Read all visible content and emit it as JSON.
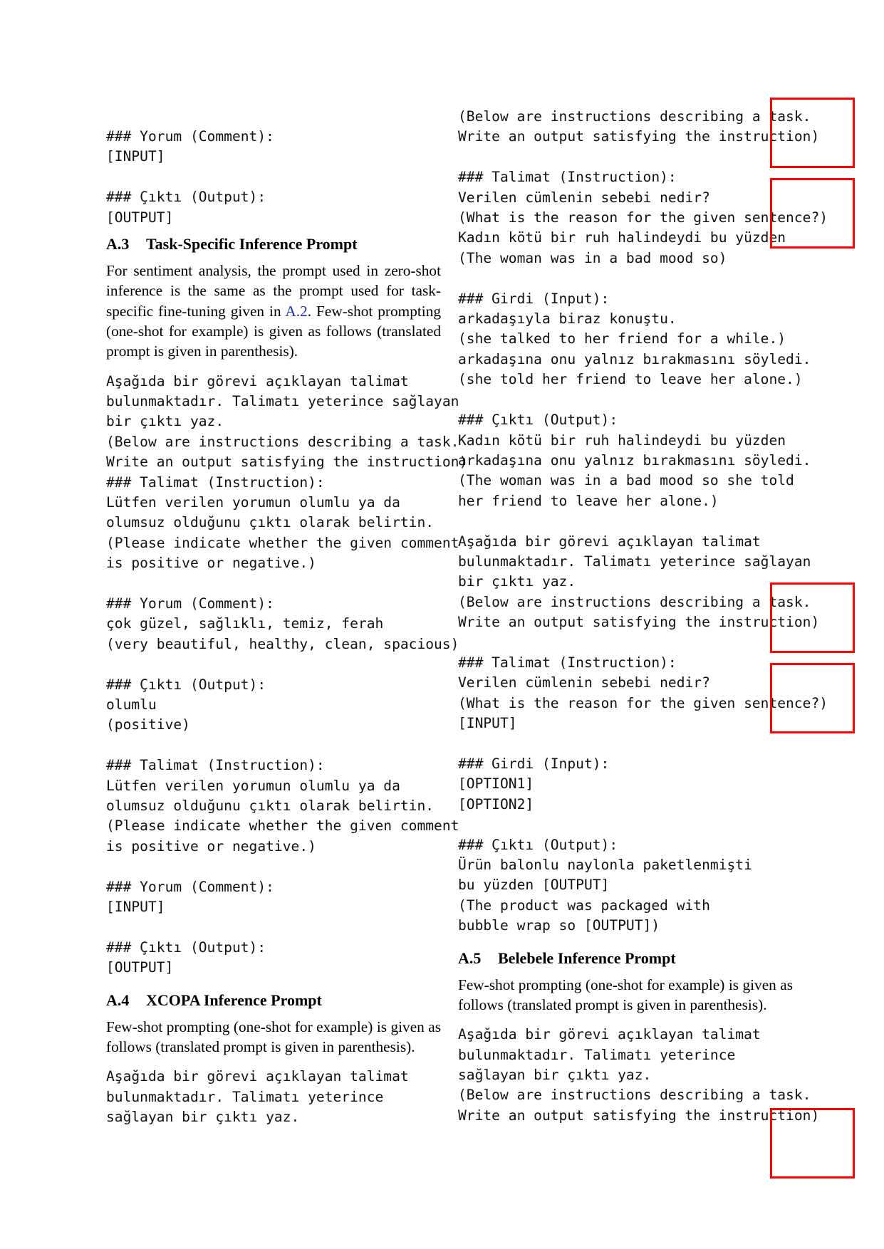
{
  "left_column": {
    "code_top": "### Yorum (Comment):\n[INPUT]\n\n### Çıktı (Output):\n[OUTPUT]",
    "section_a3": {
      "number": "A.3",
      "title": "Task-Specific Inference Prompt"
    },
    "para_a3_before": "For sentiment analysis, the prompt used in zero-shot inference is the same as the prompt used for task-specific fine-tuning given in ",
    "para_a3_ref": "A.2",
    "para_a3_after": ". Few-shot prompting (one-shot for example) is given as follows (translated prompt is given in parenthesis).",
    "code_sentiment": "Aşağıda bir görevi açıklayan talimat\nbulunmaktadır. Talimatı yeterince sağlayan\nbir çıktı yaz.\n(Below are instructions describing a task.\nWrite an output satisfying the instruction)\n### Talimat (Instruction):\nLütfen verilen yorumun olumlu ya da\nolumsuz olduğunu çıktı olarak belirtin.\n(Please indicate whether the given comment\nis positive or negative.)\n\n### Yorum (Comment):\nçok güzel, sağlıklı, temiz, ferah\n(very beautiful, healthy, clean, spacious)\n\n### Çıktı (Output):\nolumlu\n(positive)\n\n### Talimat (Instruction):\nLütfen verilen yorumun olumlu ya da\nolumsuz olduğunu çıktı olarak belirtin.\n(Please indicate whether the given comment\nis positive or negative.)\n\n### Yorum (Comment):\n[INPUT]\n\n### Çıktı (Output):\n[OUTPUT]",
    "section_a4": {
      "number": "A.4",
      "title": "XCOPA Inference Prompt"
    },
    "para_a4": "Few-shot prompting (one-shot for example) is given as follows (translated prompt is given in parenthesis).",
    "code_xcopa_start": "Aşağıda bir görevi açıklayan talimat\nbulunmaktadır. Talimatı yeterince\nsağlayan bir çıktı yaz."
  },
  "right_column": {
    "code_xcopa": "(Below are instructions describing a task.\nWrite an output satisfying the instruction)\n\n### Talimat (Instruction):\nVerilen cümlenin sebebi nedir?\n(What is the reason for the given sentence?)\nKadın kötü bir ruh halindeydi bu yüzden\n(The woman was in a bad mood so)\n\n### Girdi (Input):\narkadaşıyla biraz konuştu.\n(she talked to her friend for a while.)\narkadaşına onu yalnız bırakmasını söyledi.\n(she told her friend to leave her alone.)\n\n### Çıktı (Output):\nKadın kötü bir ruh halindeydi bu yüzden\narkadaşına onu yalnız bırakmasını söyledi.\n(The woman was in a bad mood so she told\nher friend to leave her alone.)\n\nAşağıda bir görevi açıklayan talimat\nbulunmaktadır. Talimatı yeterince sağlayan\nbir çıktı yaz.\n(Below are instructions describing a task.\nWrite an output satisfying the instruction)\n\n### Talimat (Instruction):\nVerilen cümlenin sebebi nedir?\n(What is the reason for the given sentence?)\n[INPUT]\n\n### Girdi (Input):\n[OPTION1]\n[OPTION2]\n\n### Çıktı (Output):\nÜrün balonlu naylonla paketlenmişti\nbu yüzden [OUTPUT]\n(The product was packaged with\nbubble wrap so [OUTPUT])",
    "section_a5": {
      "number": "A.5",
      "title": "Belebele Inference Prompt"
    },
    "para_a5": "Few-shot prompting (one-shot for example) is given as follows (translated prompt is given in parenthesis).",
    "code_belebele": "Aşağıda bir görevi açıklayan talimat\nbulunmaktadır. Talimatı yeterince\nsağlayan bir çıktı yaz.\n(Below are instructions describing a task.\nWrite an output satisfying the instruction)"
  },
  "colors": {
    "highlight_box": "#ff0000",
    "link": "#1a2fa8"
  }
}
